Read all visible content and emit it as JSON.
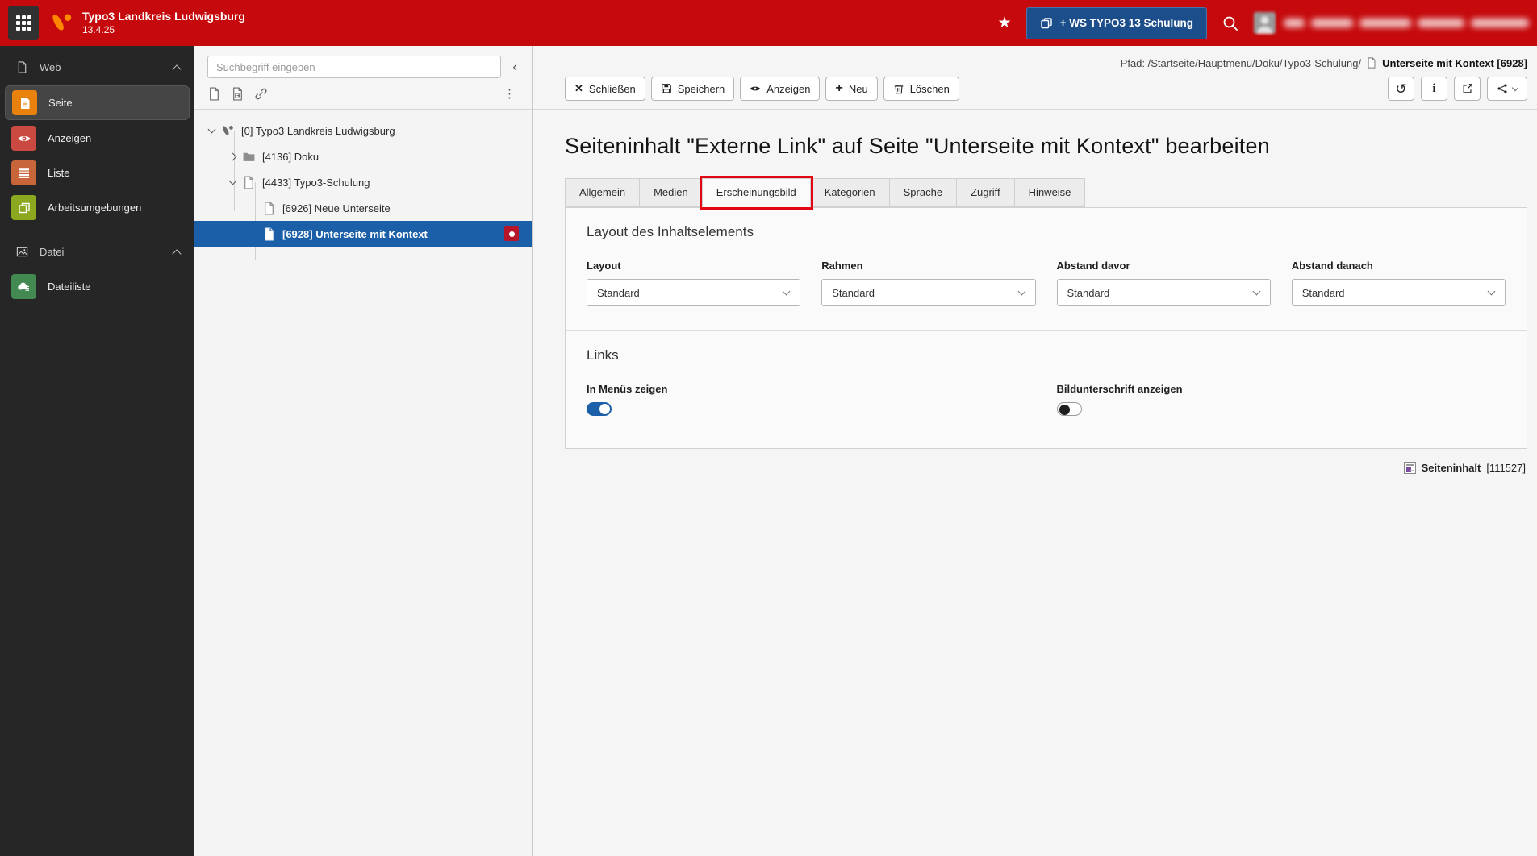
{
  "glyphs": {
    "star": "★",
    "kebab": "⋮",
    "collapse": "‹",
    "history": "↺",
    "info": "i",
    "close": "✕",
    "plus": "+"
  },
  "topbar": {
    "title": "Typo3 Landkreis Ludwigsburg",
    "version": "13.4.25",
    "workspace_button": "+ WS TYPO3 13 Schulung"
  },
  "sidebar": {
    "web_group": "Web",
    "datei_group": "Datei",
    "items": {
      "seite": "Seite",
      "anzeigen": "Anzeigen",
      "liste": "Liste",
      "arbeitsumgebungen": "Arbeitsumgebungen",
      "dateiliste": "Dateiliste"
    }
  },
  "pagetree": {
    "search_placeholder": "Suchbegriff eingeben",
    "nodes": [
      "[0] Typo3 Landkreis Ludwigsburg",
      "[4136] Doku",
      "[4433] Typo3-Schulung",
      "[6926] Neue Unterseite",
      "[6928] Unterseite mit Kontext"
    ]
  },
  "docheader": {
    "path_prefix": "Pfad: /Startseite/Hauptmenü/Doku/Typo3-Schulung/",
    "record_title": "Unterseite mit Kontext [6928]",
    "buttons": {
      "close": "Schließen",
      "save": "Speichern",
      "view": "Anzeigen",
      "new": "Neu",
      "delete": "Löschen"
    }
  },
  "content": {
    "heading": "Seiteninhalt \"Externe Link\" auf Seite \"Unterseite mit Kontext\" bearbeiten",
    "tabs": [
      "Allgemein",
      "Medien",
      "Erscheinungsbild",
      "Kategorien",
      "Sprache",
      "Zugriff",
      "Hinweise"
    ],
    "layout_section": {
      "legend": "Layout des Inhaltselements",
      "fields": [
        {
          "label": "Layout",
          "value": "Standard"
        },
        {
          "label": "Rahmen",
          "value": "Standard"
        },
        {
          "label": "Abstand davor",
          "value": "Standard"
        },
        {
          "label": "Abstand danach",
          "value": "Standard"
        }
      ]
    },
    "links_section": {
      "legend": "Links",
      "toggles": [
        {
          "label": "In Menüs zeigen",
          "state": "on"
        },
        {
          "label": "Bildunterschrift anzeigen",
          "state": "off"
        }
      ]
    },
    "footer": {
      "record_type": "Seiteninhalt",
      "record_id": "[111527]"
    }
  },
  "colors": {
    "topbar_red": "#c5090c",
    "typo3_orange": "#ff8700",
    "primary_blue": "#1a5fa8",
    "workspace_button_blue": "#1d4e8c",
    "annotation_red": "#e30613"
  }
}
